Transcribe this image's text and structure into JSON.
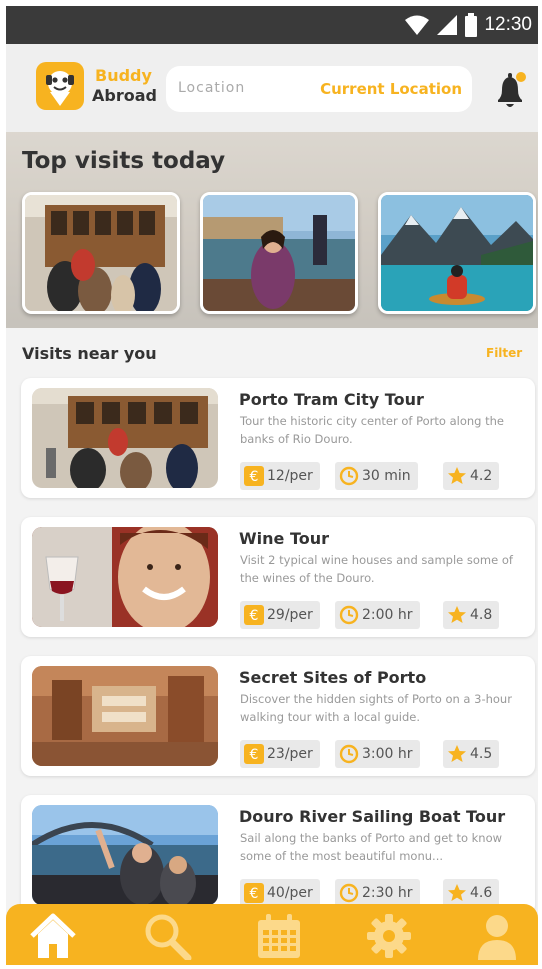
{
  "status_bar": {
    "time": "12:30"
  },
  "header": {
    "brand_line1": "Buddy",
    "brand_line2": "Abroad",
    "location_placeholder": "Location",
    "current_location_label": "Current Location"
  },
  "top_visits": {
    "title": "Top visits today"
  },
  "nearby": {
    "title": "Visits near you",
    "filter_label": "Filter",
    "visits": [
      {
        "title": "Porto Tram City Tour",
        "description": "Tour the historic city center of Porto along the banks of Rio Douro.",
        "price": "12/per",
        "duration": "30 min",
        "rating": "4.2"
      },
      {
        "title": "Wine Tour",
        "description": "Visit 2 typical wine houses and sample some of the wines of the Douro.",
        "price": "29/per",
        "duration": "2:00 hr",
        "rating": "4.8"
      },
      {
        "title": "Secret Sites of Porto",
        "description": "Discover the hidden sights of Porto on a 3-hour walking tour with a local guide.",
        "price": "23/per",
        "duration": "3:00 hr",
        "rating": "4.5"
      },
      {
        "title": "Douro River Sailing Boat Tour",
        "description": "Sail along the banks of Porto and get to know some of the most beautiful monu...",
        "price": "40/per",
        "duration": "2:30 hr",
        "rating": "4.6"
      }
    ]
  },
  "bottom_nav": {
    "items": [
      {
        "icon": "home-icon",
        "active": true
      },
      {
        "icon": "search-icon",
        "active": false
      },
      {
        "icon": "calendar-icon",
        "active": false
      },
      {
        "icon": "gear-icon",
        "active": false
      },
      {
        "icon": "profile-icon",
        "active": false
      }
    ]
  },
  "colors": {
    "accent": "#f7b320",
    "status_bar": "#3a3a3a",
    "background": "#f3f3f3"
  }
}
